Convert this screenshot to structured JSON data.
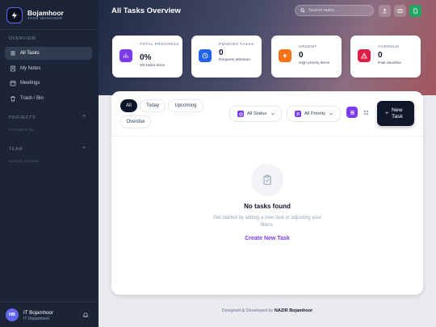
{
  "brand": {
    "name": "Bojamhoor",
    "subtitle": "TASK MANAGER"
  },
  "sidebar": {
    "overview_label": "OVERVIEW",
    "items": [
      {
        "label": "All Tasks",
        "icon": "list-icon",
        "active": true
      },
      {
        "label": "My Notes",
        "icon": "note-icon"
      },
      {
        "label": "Meetings",
        "icon": "calendar-icon"
      },
      {
        "label": "Trash / Bin",
        "icon": "trash-icon"
      }
    ],
    "projects_label": "PROJECTS",
    "projects_empty": "No projects yet",
    "team_label": "TEAM",
    "team_empty": "No team members",
    "user": {
      "initials": "NB",
      "name": "IT Bojamhoor",
      "dept": "IT Department"
    }
  },
  "header": {
    "title": "All Tasks Overview",
    "search_placeholder": "Search tasks..."
  },
  "stats": [
    {
      "label": "TOTAL PROGRESS",
      "value": "0%",
      "sub": "0/0 tasks done",
      "color": "#7c3aed",
      "icon": "chart-icon"
    },
    {
      "label": "PENDING TASKS",
      "value": "0",
      "sub": "Requires attention",
      "color": "#2563eb",
      "icon": "clock-icon"
    },
    {
      "label": "URGENT",
      "value": "0",
      "sub": "High priority items",
      "color": "#f97316",
      "icon": "lightning-icon"
    },
    {
      "label": "OVERDUE",
      "value": "0",
      "sub": "Past deadline",
      "color": "#e11d48",
      "icon": "warning-icon"
    }
  ],
  "filters": {
    "tabs": [
      "All",
      "Today",
      "Upcoming",
      "Overdue"
    ],
    "status_label": "All Status",
    "priority_label": "All Priority",
    "new_task_label": "New Task"
  },
  "empty_state": {
    "title": "No tasks found",
    "description": "Get started by adding a new task or adjusting your filters.",
    "action": "Create New Task"
  },
  "footer": {
    "prefix": "Designed & Developed by",
    "author": "NAZIR Bojamhoor"
  },
  "colors": {
    "accent": "#7c3aed",
    "sidebar": "#1b2537",
    "dark": "#0f172a"
  }
}
